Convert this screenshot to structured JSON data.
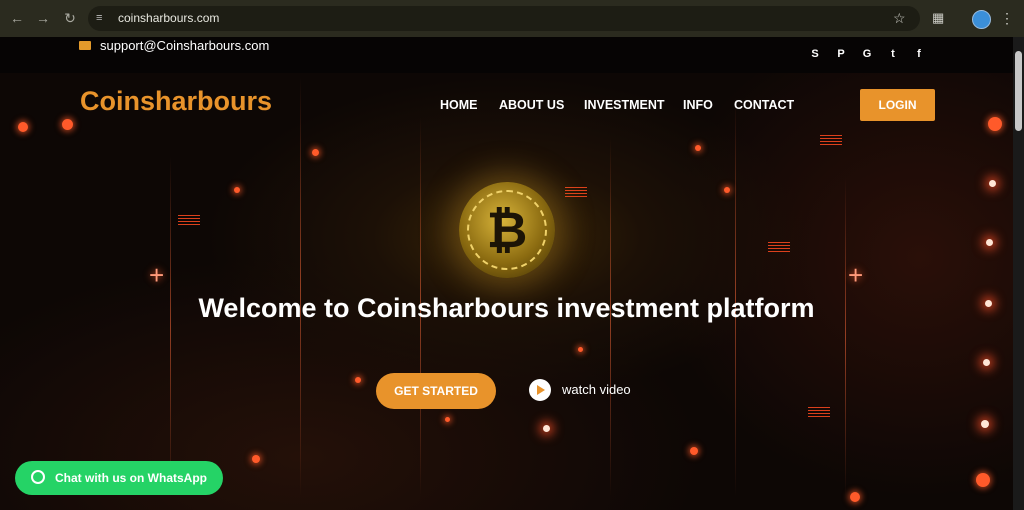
{
  "browser": {
    "url": "coinsharbours.com",
    "icons": {
      "back": "arrow-left-icon",
      "forward": "arrow-right-icon",
      "reload": "reload-icon",
      "site_info": "tune-icon",
      "bookmark": "star-icon",
      "extensions": "puzzle-icon",
      "profile": "avatar-icon",
      "menu": "more-vert-icon"
    }
  },
  "topbar": {
    "email": "support@Coinsharbours.com",
    "social": [
      "skype-icon",
      "pinterest-icon",
      "google-icon",
      "twitter-icon",
      "facebook-icon"
    ]
  },
  "nav": {
    "brand": "Coinsharbours",
    "items": [
      "HOME",
      "ABOUT US",
      "INVESTMENT",
      "INFO",
      "CONTACT"
    ],
    "login": "LOGIN"
  },
  "hero": {
    "headline": "Welcome to Coinsharbours investment platform",
    "cta": "GET STARTED",
    "watch": "watch video",
    "coin_symbol": "₿"
  },
  "whatsapp": {
    "label": "Chat with us on WhatsApp"
  },
  "colors": {
    "accent": "#e8932b",
    "whatsapp": "#25d366",
    "chrome": "#2b2b1f"
  }
}
